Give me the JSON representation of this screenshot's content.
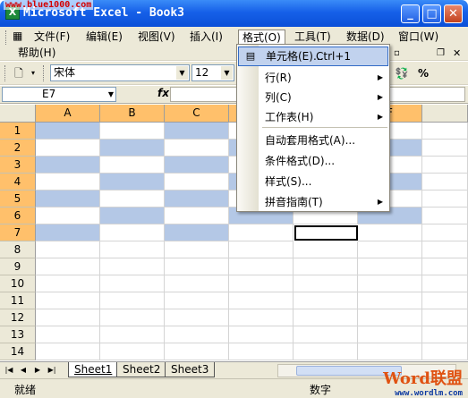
{
  "window": {
    "title": "Microsoft Excel - Book3",
    "watermark": "www.blue1000.com"
  },
  "menubar": {
    "items": [
      "文件(F)",
      "编辑(E)",
      "视图(V)",
      "插入(I)",
      "格式(O)",
      "工具(T)",
      "数据(D)",
      "窗口(W)"
    ],
    "help": "帮助(H)",
    "active": "格式(O)"
  },
  "toolbar": {
    "font_name": "宋体",
    "font_size": "12",
    "percent_icon": "%"
  },
  "formula_bar": {
    "name_box": "E7",
    "fx": "fx",
    "content": ""
  },
  "sheet": {
    "columns": [
      "A",
      "B",
      "C",
      "D",
      "E",
      "F"
    ],
    "rows": [
      "1",
      "2",
      "3",
      "4",
      "5",
      "6",
      "7",
      "8",
      "9",
      "10",
      "11",
      "12",
      "13",
      "14"
    ],
    "active_cell": "E7",
    "shade_color": "#b4c8e6",
    "header_highlight_color": "#ffc06b"
  },
  "format_menu": {
    "items": [
      {
        "label": "单元格(E)...",
        "shortcut": "Ctrl+1",
        "submenu": false,
        "icon": "cells-icon"
      },
      {
        "label": "行(R)",
        "submenu": true
      },
      {
        "label": "列(C)",
        "submenu": true
      },
      {
        "label": "工作表(H)",
        "submenu": true
      },
      {
        "label": "自动套用格式(A)...",
        "submenu": false
      },
      {
        "label": "条件格式(D)...",
        "submenu": false
      },
      {
        "label": "样式(S)...",
        "submenu": false
      },
      {
        "label": "拼音指南(T)",
        "submenu": true
      }
    ]
  },
  "sheet_tabs": [
    "Sheet1",
    "Sheet2",
    "Sheet3"
  ],
  "active_tab": "Sheet1",
  "status": {
    "left": "就绪",
    "mode": "数字"
  },
  "brand": {
    "logo": "Word联盟",
    "url": "www.wordlm.com"
  }
}
